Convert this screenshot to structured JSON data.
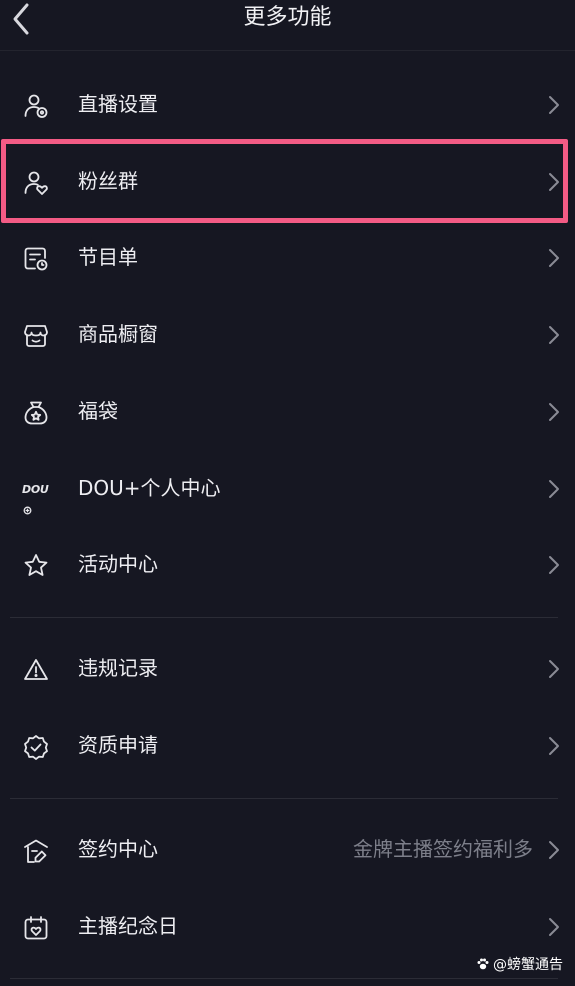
{
  "nav": {
    "title": "更多功能"
  },
  "menu": {
    "items": [
      {
        "id": "live-settings",
        "label": "直播设置",
        "icon": "user-settings-icon"
      },
      {
        "id": "fan-group",
        "label": "粉丝群",
        "icon": "user-heart-icon",
        "highlighted": true
      },
      {
        "id": "program-list",
        "label": "节目单",
        "icon": "program-list-icon"
      },
      {
        "id": "product-showcase",
        "label": "商品橱窗",
        "icon": "storefront-icon"
      },
      {
        "id": "lucky-bag",
        "label": "福袋",
        "icon": "lucky-bag-icon"
      },
      {
        "id": "dou-plus",
        "label": "DOU+个人中心",
        "icon": "dou-logo-icon",
        "icon_text": "DOU"
      },
      {
        "id": "activity-center",
        "label": "活动中心",
        "icon": "star-icon"
      },
      {
        "id": "violation-record",
        "label": "违规记录",
        "icon": "warning-icon"
      },
      {
        "id": "qualification-application",
        "label": "资质申请",
        "icon": "verified-badge-icon"
      },
      {
        "id": "contract-center",
        "label": "签约中心",
        "icon": "contract-icon",
        "hint": "金牌主播签约福利多"
      },
      {
        "id": "anniversary",
        "label": "主播纪念日",
        "icon": "calendar-heart-icon"
      }
    ]
  },
  "watermark": {
    "text": "@螃蟹通告"
  },
  "colors": {
    "background": "#161722",
    "highlight_border": "#f35b85",
    "text": "#eeeef2",
    "hint_text": "#7d7f8a"
  }
}
